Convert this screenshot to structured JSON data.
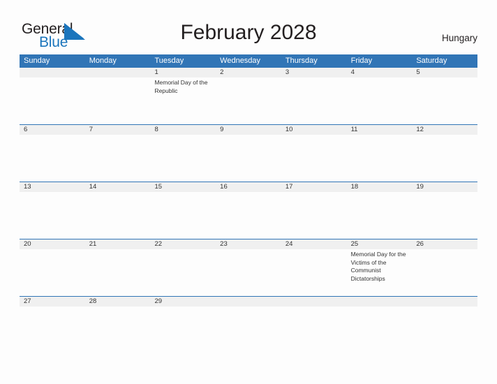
{
  "brand": {
    "name_part1": "General",
    "name_part2": "Blue",
    "triangle_color": "#1b75bc",
    "text_color": "#231f20",
    "blue_text_color": "#1b75bc"
  },
  "header": {
    "title": "February 2028",
    "country": "Hungary"
  },
  "colors": {
    "header_blue": "#3175b6",
    "band_gray": "#f0f0f0",
    "page_background": "#fdfdfd",
    "text": "#333333"
  },
  "calendar": {
    "weekdays": [
      "Sunday",
      "Monday",
      "Tuesday",
      "Wednesday",
      "Thursday",
      "Friday",
      "Saturday"
    ],
    "weeks": [
      {
        "days": [
          {
            "number": "",
            "event": ""
          },
          {
            "number": "",
            "event": ""
          },
          {
            "number": "1",
            "event": "Memorial Day of the Republic"
          },
          {
            "number": "2",
            "event": ""
          },
          {
            "number": "3",
            "event": ""
          },
          {
            "number": "4",
            "event": ""
          },
          {
            "number": "5",
            "event": ""
          }
        ]
      },
      {
        "days": [
          {
            "number": "6",
            "event": ""
          },
          {
            "number": "7",
            "event": ""
          },
          {
            "number": "8",
            "event": ""
          },
          {
            "number": "9",
            "event": ""
          },
          {
            "number": "10",
            "event": ""
          },
          {
            "number": "11",
            "event": ""
          },
          {
            "number": "12",
            "event": ""
          }
        ]
      },
      {
        "days": [
          {
            "number": "13",
            "event": ""
          },
          {
            "number": "14",
            "event": ""
          },
          {
            "number": "15",
            "event": ""
          },
          {
            "number": "16",
            "event": ""
          },
          {
            "number": "17",
            "event": ""
          },
          {
            "number": "18",
            "event": ""
          },
          {
            "number": "19",
            "event": ""
          }
        ]
      },
      {
        "days": [
          {
            "number": "20",
            "event": ""
          },
          {
            "number": "21",
            "event": ""
          },
          {
            "number": "22",
            "event": ""
          },
          {
            "number": "23",
            "event": ""
          },
          {
            "number": "24",
            "event": ""
          },
          {
            "number": "25",
            "event": "Memorial Day for the Victims of the Communist Dictatorships"
          },
          {
            "number": "26",
            "event": ""
          }
        ]
      },
      {
        "days": [
          {
            "number": "27",
            "event": ""
          },
          {
            "number": "28",
            "event": ""
          },
          {
            "number": "29",
            "event": ""
          },
          {
            "number": "",
            "event": ""
          },
          {
            "number": "",
            "event": ""
          },
          {
            "number": "",
            "event": ""
          },
          {
            "number": "",
            "event": ""
          }
        ]
      }
    ]
  }
}
